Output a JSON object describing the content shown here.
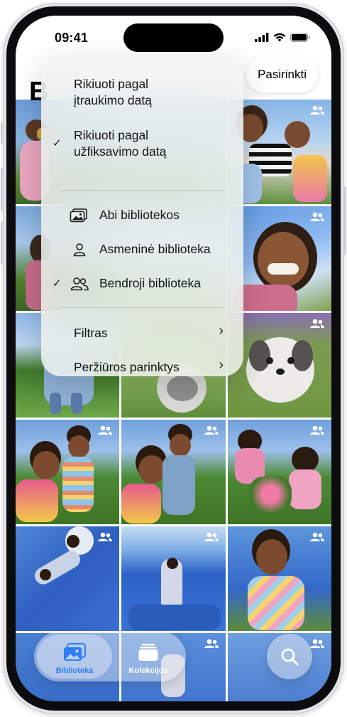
{
  "status": {
    "time": "09:41"
  },
  "header": {
    "title": "B",
    "select_label": "Pasirinkti"
  },
  "menu": {
    "sort_items": [
      {
        "label_line1": "Rikiuoti pagal",
        "label_line2": "įtraukimo datą",
        "checked": false
      },
      {
        "label_line1": "Rikiuoti pagal",
        "label_line2": "užfiksavimo datą",
        "checked": true
      }
    ],
    "check_mark": "✓",
    "library_items": [
      {
        "label": "Abi bibliotekos",
        "icon": "photo-stack-icon",
        "checked": false
      },
      {
        "label": "Asmeninė biblioteka",
        "icon": "person-icon",
        "checked": false
      },
      {
        "label": "Bendroji biblioteka",
        "icon": "two-people-icon",
        "checked": true
      }
    ],
    "nav_items": [
      {
        "label": "Filtras",
        "chevron": "›"
      },
      {
        "label": "Peržiūros parinktys",
        "chevron": "›"
      }
    ]
  },
  "tab_bar": {
    "library_label": "Biblioteka",
    "collections_label": "Kolekcijos",
    "active_tab": "Biblioteka",
    "accent_color": "#2f7cf6"
  },
  "search": {
    "icon": "magnifier-icon"
  },
  "grid": {
    "shared_badge_icon": "shared-people-icon"
  }
}
